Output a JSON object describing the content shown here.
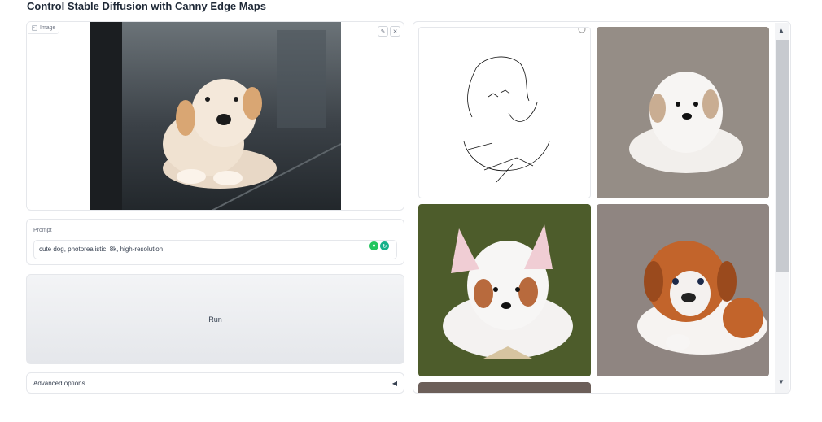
{
  "page": {
    "title": "Control Stable Diffusion with Canny Edge Maps"
  },
  "image_input": {
    "label": "Image",
    "edit_icon": "pencil-icon",
    "clear_icon": "close-icon"
  },
  "prompt": {
    "label": "Prompt",
    "value": "cute dog, photorealistic, 8k, high-resolution"
  },
  "run": {
    "label": "Run"
  },
  "advanced": {
    "label": "Advanced options",
    "toggle_icon": "triangle-left-icon"
  },
  "gallery": {
    "items": [
      {
        "name": "canny-edge-map"
      },
      {
        "name": "generated-puppy-white"
      },
      {
        "name": "generated-puppy-fluffy"
      },
      {
        "name": "generated-puppy-bulldog"
      }
    ]
  },
  "colors": {
    "accent": "#10a37f",
    "border": "#e5e7eb",
    "button_bg": "#eceef1"
  }
}
